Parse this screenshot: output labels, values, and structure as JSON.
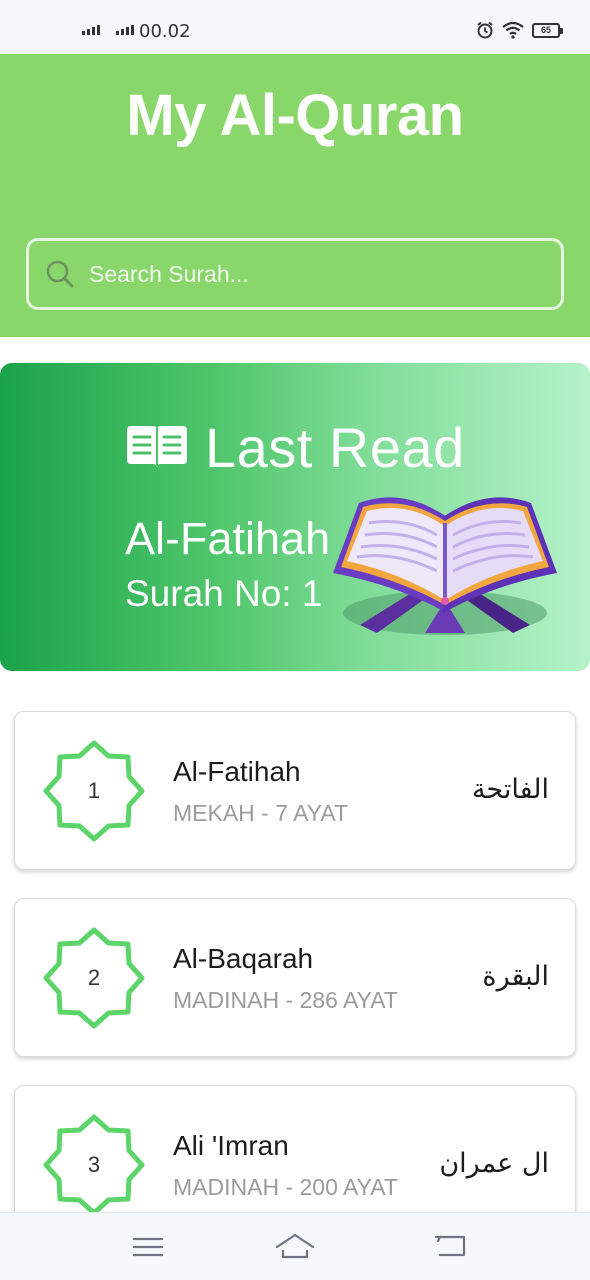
{
  "status_bar": {
    "time": "00.02",
    "battery": "65",
    "icons": [
      "signal-icon",
      "signal-icon",
      "alarm-icon",
      "wifi-icon",
      "battery-icon"
    ]
  },
  "header": {
    "title": "My Al-Quran",
    "search_placeholder": "Search Surah...",
    "background_color": "#89d66b"
  },
  "last_read": {
    "title": "Last Read",
    "surah_name": "Al-Fatihah",
    "surah_number_text": "Surah No: 1",
    "icons": [
      "book-open-icon",
      "quran-book-illustration"
    ]
  },
  "surahs": [
    {
      "number": "1",
      "name": "Al-Fatihah",
      "info": "MEKAH - 7 AYAT",
      "arabic": "الفاتحة"
    },
    {
      "number": "2",
      "name": "Al-Baqarah",
      "info": "MADINAH - 286 AYAT",
      "arabic": "البقرة"
    },
    {
      "number": "3",
      "name": "Ali 'Imran",
      "info": "MADINAH - 200 AYAT",
      "arabic": "ال عمران"
    }
  ],
  "nav_bar": {
    "icons": [
      "menu-icon",
      "home-icon",
      "back-icon"
    ]
  },
  "colors": {
    "accent_green": "#89d66b",
    "star_green": "#5cd46a",
    "gradient_start": "#1aa34a",
    "gradient_end": "#b5f2c9"
  }
}
